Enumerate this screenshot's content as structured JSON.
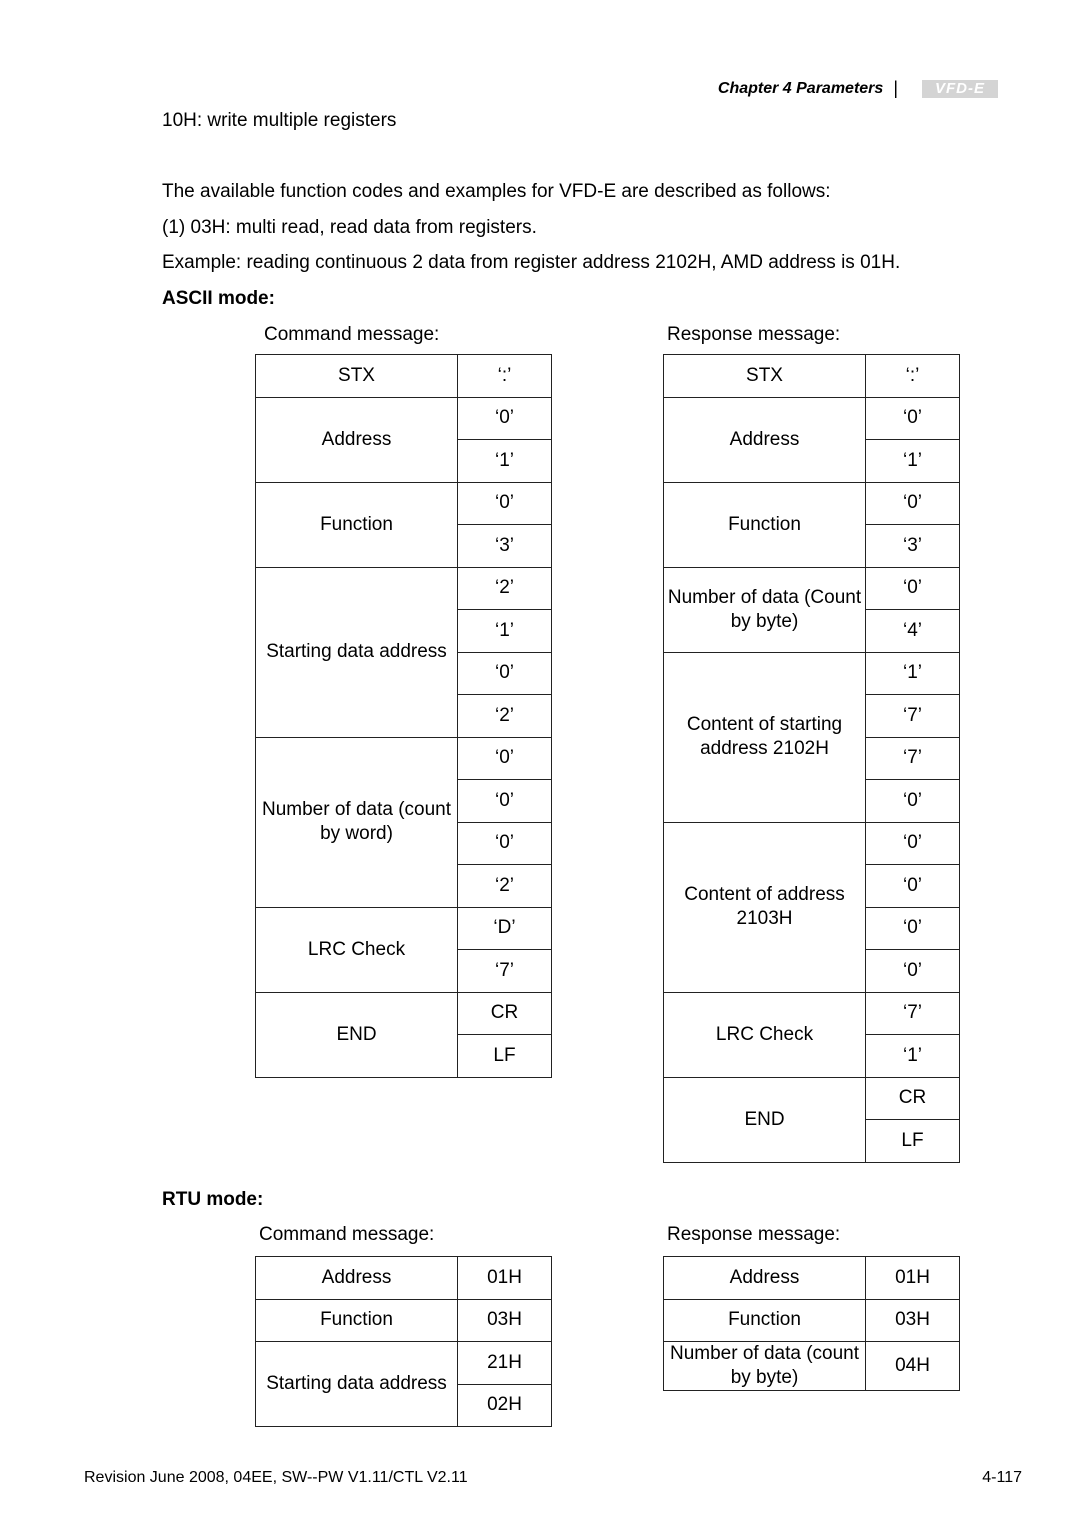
{
  "header": {
    "chapter": "Chapter 4 Parameters",
    "separator": "|",
    "logo_text": "VFD-E"
  },
  "body": {
    "line1": "10H: write multiple registers",
    "line2": "The available function codes and examples for VFD-E are described as follows:",
    "line3": "(1) 03H: multi read, read data from registers.",
    "line4": "Example: reading continuous 2 data from register address 2102H, AMD address is 01H."
  },
  "ascii": {
    "title": "ASCII mode:",
    "command_label": "Command message:",
    "response_label": "Response message:",
    "command": [
      {
        "name": "STX",
        "values": [
          "‘:’"
        ]
      },
      {
        "name": "Address",
        "values": [
          "‘0’",
          "‘1’"
        ]
      },
      {
        "name": "Function",
        "values": [
          "‘0’",
          "‘3’"
        ]
      },
      {
        "name": "Starting data address",
        "values": [
          "‘2’",
          "‘1’",
          "‘0’",
          "‘2’"
        ]
      },
      {
        "name": "Number of data (count by word)",
        "values": [
          "‘0’",
          "‘0’",
          "‘0’",
          "‘2’"
        ]
      },
      {
        "name": "LRC Check",
        "values": [
          "‘D’",
          "‘7’"
        ]
      },
      {
        "name": "END",
        "values": [
          "CR",
          "LF"
        ]
      }
    ],
    "response": [
      {
        "name": "STX",
        "values": [
          "‘:’"
        ]
      },
      {
        "name": "Address",
        "values": [
          "‘0’",
          "‘1’"
        ]
      },
      {
        "name": "Function",
        "values": [
          "‘0’",
          "‘3’"
        ]
      },
      {
        "name": "Number of data (Count by byte)",
        "values": [
          "‘0’",
          "‘4’"
        ]
      },
      {
        "name": "Content of starting address 2102H",
        "values": [
          "‘1’",
          "‘7’",
          "‘7’",
          "‘0’"
        ]
      },
      {
        "name": "Content of address 2103H",
        "values": [
          "‘0’",
          "‘0’",
          "‘0’",
          "‘0’"
        ]
      },
      {
        "name": "LRC Check",
        "values": [
          "‘7’",
          "‘1’"
        ]
      },
      {
        "name": "END",
        "values": [
          "CR",
          "LF"
        ]
      }
    ]
  },
  "rtu": {
    "title": "RTU mode:",
    "command_label": "Command message:",
    "response_label": "Response message:",
    "command": [
      {
        "name": "Address",
        "values": [
          "01H"
        ]
      },
      {
        "name": "Function",
        "values": [
          "03H"
        ]
      },
      {
        "name": "Starting data address",
        "values": [
          "21H",
          "02H"
        ]
      }
    ],
    "response": [
      {
        "name": "Address",
        "values": [
          "01H"
        ]
      },
      {
        "name": "Function",
        "values": [
          "03H"
        ]
      },
      {
        "name": "Number of data (count by byte)",
        "values": [
          "04H"
        ],
        "rows": 2
      }
    ]
  },
  "footer": {
    "revision": "Revision June 2008, 04EE, SW--PW V1.11/CTL V2.11",
    "page": "4-117"
  }
}
